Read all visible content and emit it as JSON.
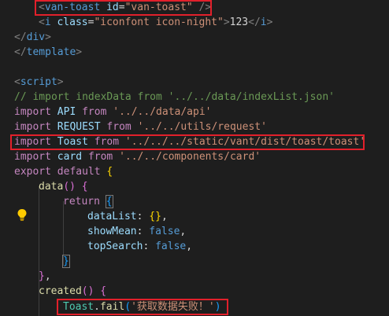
{
  "code": {
    "line1": {
      "lt": "<",
      "tag": "van-toast",
      "attr": "id",
      "eq": "=",
      "val": "\"van-toast\"",
      "close": " />"
    },
    "line2": {
      "lt": "<",
      "tag": "i",
      "attr": "class",
      "eq": "=",
      "val": "\"iconfont icon-night\"",
      "gt": ">",
      "text": "123",
      "lt2": "</",
      "tag2": "i",
      "gt2": ">"
    },
    "line3": {
      "lt": "</",
      "tag": "div",
      "gt": ">"
    },
    "line4": {
      "lt": "</",
      "tag": "template",
      "gt": ">"
    },
    "line6": {
      "lt": "<",
      "tag": "script",
      "gt": ">"
    },
    "line7": {
      "comment": "// import indexData from '../../data/indexList.json'"
    },
    "line8": {
      "kw": "import",
      "name": "API",
      "from": "from",
      "path": "'../../data/api'"
    },
    "line9": {
      "kw": "import",
      "name": "REQUEST",
      "from": "from",
      "path": "'../../utils/request'"
    },
    "line10": {
      "kw": "import",
      "name": "Toast",
      "from": "from",
      "path": "'../../../static/vant/dist/toast/toast'"
    },
    "line11": {
      "kw": "import",
      "name": "card",
      "from": "from",
      "path": "'../../components/card'"
    },
    "line12": {
      "kw1": "export",
      "kw2": "default",
      "brace": "{"
    },
    "line13": {
      "func": "data",
      "parens": "()",
      "brace": "{"
    },
    "line14": {
      "kw": "return",
      "brace": "{"
    },
    "line15": {
      "prop": "dataList",
      "colon": ":",
      "value": "{}",
      "comma": ","
    },
    "line16": {
      "prop": "showMean",
      "colon": ":",
      "value": "false",
      "comma": ","
    },
    "line17": {
      "prop": "topSearch",
      "colon": ":",
      "value": "false",
      "comma": ","
    },
    "line18": {
      "brace": "}"
    },
    "line19": {
      "brace": "}",
      "comma": ","
    },
    "line20": {
      "func": "created",
      "parens": "()",
      "brace": "{"
    },
    "line21": {
      "obj": "Toast",
      "dot": ".",
      "method": "fail",
      "open": "(",
      "str": "'获取数据失败！'",
      "close": ")"
    }
  },
  "colors": {
    "background": "#1e1e1e",
    "highlight_border": "#e2202b",
    "keyword": "#569cd6",
    "control": "#c586c0",
    "string": "#ce9178",
    "comment": "#6a9955",
    "variable": "#9cdcfe",
    "function": "#dcdcaa"
  },
  "icons": {
    "lightbulb": "lightbulb-icon"
  }
}
